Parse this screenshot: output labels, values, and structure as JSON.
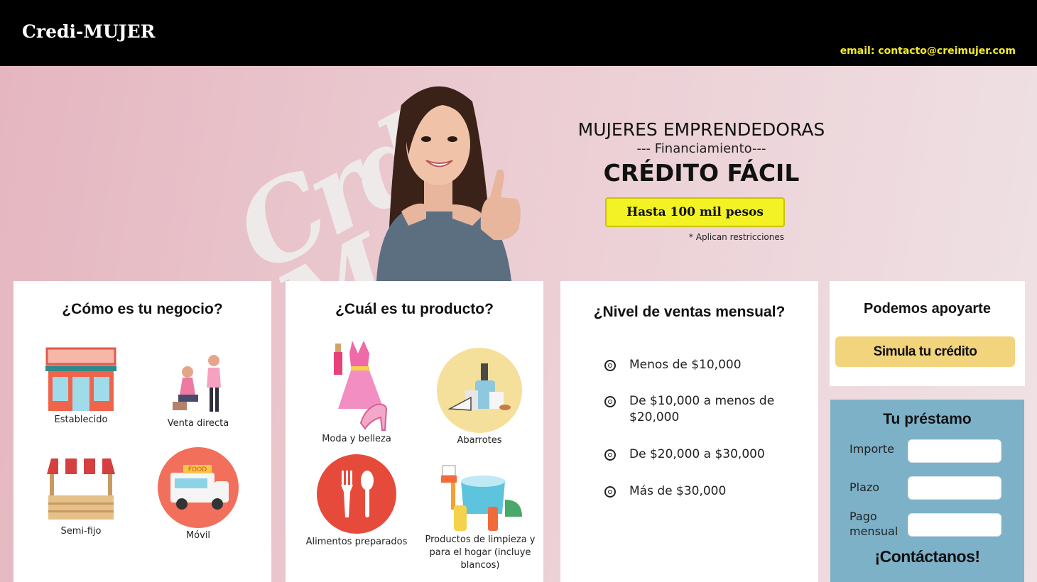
{
  "header": {
    "brand": "Credi-MUJER",
    "email": "email: contacto@creimujer.com"
  },
  "hero": {
    "title": "MUJERES EMPRENDEDORAS",
    "subtitle": "--- Financiamiento---",
    "headline": "CRÉDITO FÁCIL",
    "amount_badge": "Hasta 100 mil pesos",
    "restrictions_note": "* Aplican restricciones"
  },
  "negocio": {
    "title": "¿Cómo es tu negocio?",
    "items": [
      {
        "label": "Establecido",
        "icon": "storefront-icon"
      },
      {
        "label": "Venta directa",
        "icon": "direct-sales-icon"
      },
      {
        "label": "Semi-fijo",
        "icon": "market-stall-icon"
      },
      {
        "label": "Móvil",
        "icon": "food-truck-icon",
        "badge": "FOOD"
      }
    ]
  },
  "producto": {
    "title": "¿Cuál es tu producto?",
    "items": [
      {
        "label": "Moda y belleza",
        "icon": "dress-icon"
      },
      {
        "label": "Abarrotes",
        "icon": "groceries-icon"
      },
      {
        "label": "Alimentos preparados",
        "icon": "fork-spoon-icon"
      },
      {
        "label": "Productos de limpieza y para el hogar (incluye blancos)",
        "icon": "cleaning-icon"
      }
    ]
  },
  "ventas": {
    "title": "¿Nivel de ventas mensual?",
    "options": [
      "Menos de $10,000",
      "De $10,000 a menos de $20,000",
      "De $20,000 a $30,000",
      "Más de $30,000"
    ]
  },
  "apoyo": {
    "title": "Podemos apoyarte",
    "button": "Simula tu crédito"
  },
  "prestamo": {
    "title": "Tu préstamo",
    "fields": [
      {
        "label": "Importe",
        "value": ""
      },
      {
        "label": "Plazo",
        "value": ""
      },
      {
        "label": "Pago mensual",
        "value": ""
      }
    ],
    "contact": "¡Contáctanos!"
  },
  "colors": {
    "topbar": "#000000",
    "email_text": "#f3ea2c",
    "badge_yellow": "#f2f224",
    "simulate_button": "#f2d47c",
    "loan_panel": "#7cb1c8"
  }
}
